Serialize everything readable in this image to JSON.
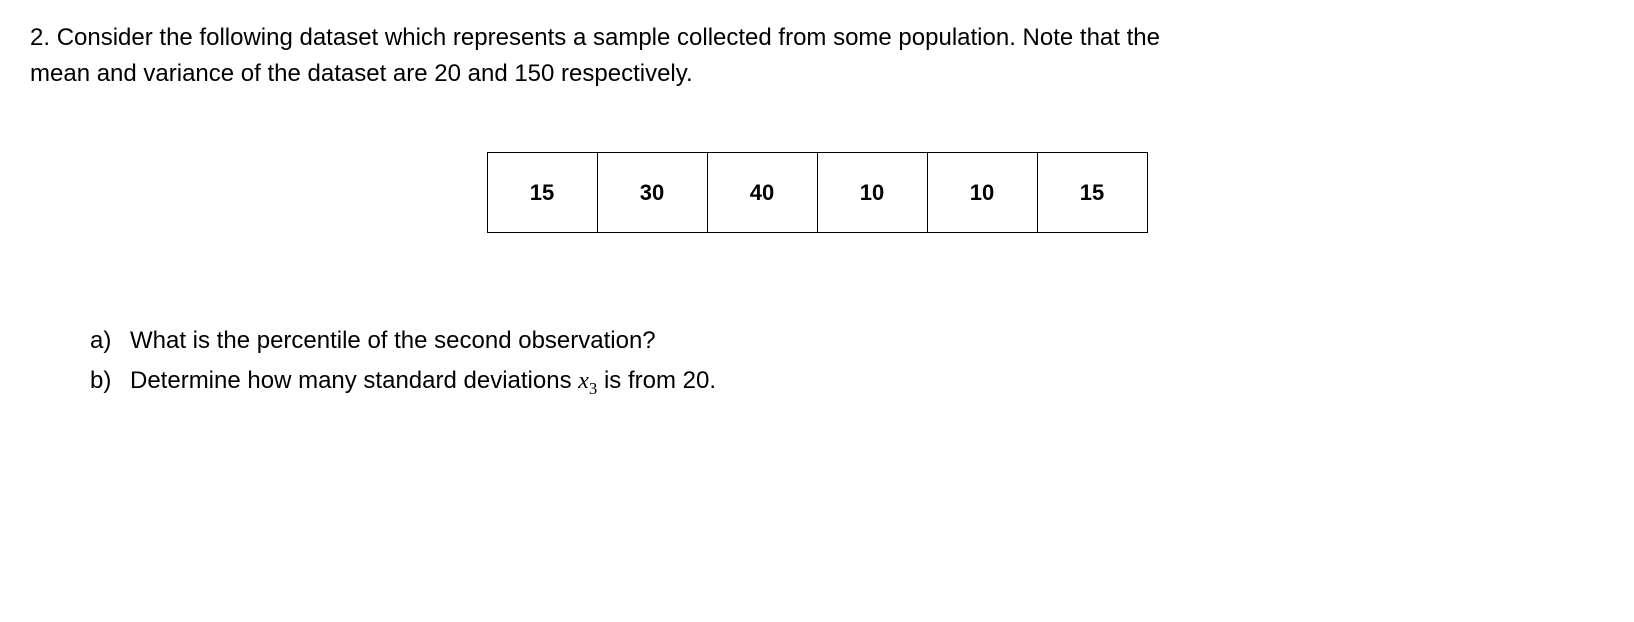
{
  "question": {
    "number": "2.",
    "text_part1": "Consider the following dataset which represents a sample collected from some population. Note that the",
    "text_part2": "mean and variance of the dataset are 20 and 150 respectively."
  },
  "data_values": [
    "15",
    "30",
    "40",
    "10",
    "10",
    "15"
  ],
  "sub_questions": {
    "a": {
      "label": "a)",
      "text": "What is the percentile of the second observation?"
    },
    "b": {
      "label": "b)",
      "text_before": "Determine how many standard deviations ",
      "var": "x",
      "sub": "3",
      "text_after": " is from 20."
    }
  }
}
